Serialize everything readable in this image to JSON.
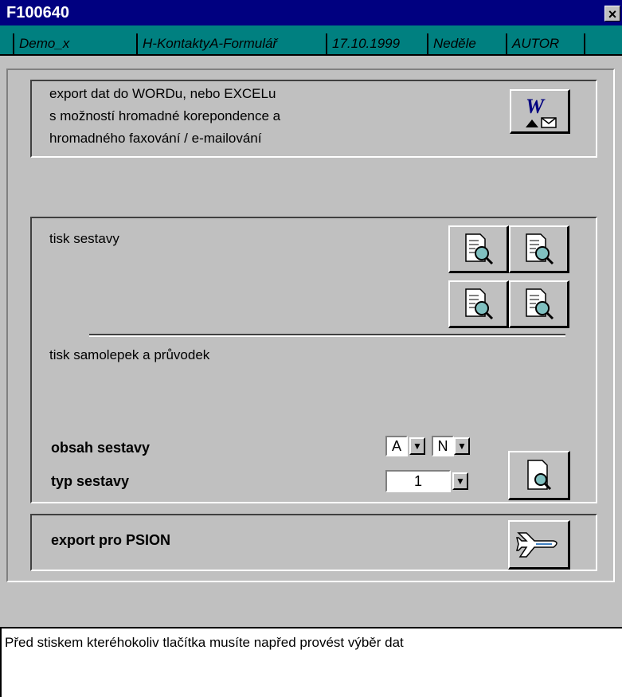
{
  "window": {
    "title": "F100640",
    "close": "×"
  },
  "info": [
    "Demo_x",
    "H-KontaktyA-Formulář",
    "17.10.1999",
    "Neděle",
    "AUTOR"
  ],
  "export_word": {
    "lines": [
      "export dat do WORDu, nebo EXCELu",
      "s možností hromadné korepondence a",
      "hromadného faxování / e-mailování"
    ],
    "icon": "word-mail-icon"
  },
  "print": {
    "report_label": "tisk sestavy",
    "labels_label": "tisk samolepek a průvodek",
    "content_label": "obsah sestavy",
    "type_label": "typ sestavy",
    "content_values": [
      "A",
      "N"
    ],
    "type_value": "1"
  },
  "psion": {
    "label": "export pro PSION",
    "icon": "airplane-icon"
  },
  "status": "Před stiskem kteréhokoliv tlačítka musíte napřed provést výběr dat",
  "colors": {
    "titlebar": "#000080",
    "infobar": "#008080",
    "panel": "#c0c0c0"
  }
}
